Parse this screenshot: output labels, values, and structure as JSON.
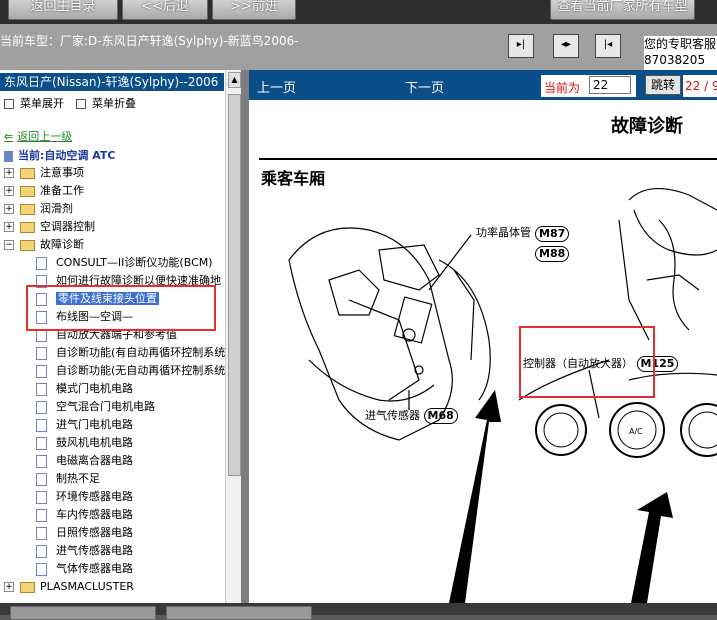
{
  "toolbar": {
    "main_menu": "返回主目录",
    "back": "<<后退",
    "forward": ">>前进",
    "all_models": "查看当前厂家所有车型"
  },
  "info": {
    "current_model": "当前车型：厂家:D-东风日产轩逸(Sylphy)-新蓝鸟2006-",
    "right_line1": "您的专职客服",
    "right_line2": "87038205"
  },
  "tree": {
    "header": "东风日产(Nissan)-轩逸(Sylphy)--2006",
    "expand": "菜单展开",
    "collapse": "菜单折叠",
    "back_up": "返回上一级",
    "current": "当前:自动空调 ATC",
    "folders": [
      "注意事项",
      "准备工作",
      "润滑剂",
      "空调器控制",
      "故障诊断"
    ],
    "docs": [
      "CONSULT—II诊断仪功能(BCM)",
      "如何进行故障诊断以便快速准确地",
      "零件及线束接头位置",
      "布线图—空调—",
      "自动放大器端子和参考值",
      "自诊断功能(有自动再循环控制系统",
      "自诊断功能(无自动再循环控制系统",
      "模式门电机电路",
      "空气混合门电机电路",
      "进气门电机电路",
      "鼓风机电机电路",
      "电磁离合器电路",
      "制热不足",
      "环境传感器电路",
      "车内传感器电路",
      "日照传感器电路",
      "进气传感器电路",
      "气体传感器电路"
    ],
    "last_folder": "PLASMACLUSTER"
  },
  "nav": {
    "prev": "上一页",
    "next": "下一页",
    "page_label": "当前为",
    "page_value": "22",
    "go": "跳转",
    "total": "22 / 9"
  },
  "document": {
    "title": "故障诊断",
    "section": "乘客车厢",
    "labels": {
      "power_transistor": "功率晶体管",
      "m87": "M87",
      "m88": "M88",
      "controller": "控制器（自动放大器）",
      "m125": "M125",
      "intake_sensor": "进气传感器",
      "m68": "M68"
    }
  },
  "colors": {
    "header_blue": "#0b4f8a",
    "highlight_red": "#e23030",
    "page_red": "#e01010"
  }
}
